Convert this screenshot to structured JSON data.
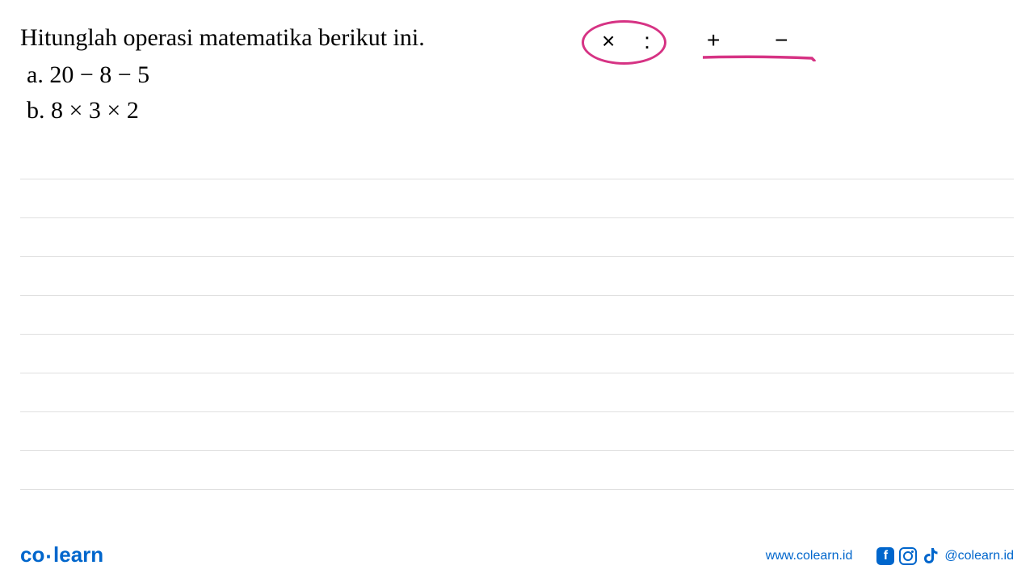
{
  "question": {
    "title": "Hitunglah operasi matematika berikut ini.",
    "items": [
      {
        "label": "a.",
        "expression": "20 − 8 − 5"
      },
      {
        "label": "b.",
        "expression": "8 × 3 × 2"
      }
    ]
  },
  "annotation": {
    "circled": "× :",
    "plusMinus": "+ −"
  },
  "footer": {
    "logo": {
      "co": "co",
      "learn": "learn"
    },
    "website": "www.colearn.id",
    "socialHandle": "@colearn.id"
  }
}
